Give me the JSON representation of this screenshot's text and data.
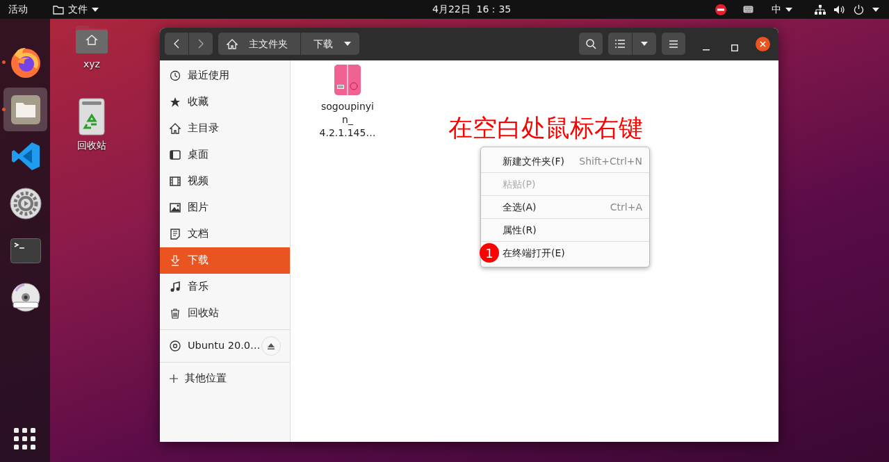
{
  "top_bar": {
    "activities": "活动",
    "app_menu": "文件",
    "clock": "4月22日  16：35",
    "input_method": "中"
  },
  "dock": {
    "apps": [
      {
        "kind": "firefox",
        "running": true,
        "selected": false
      },
      {
        "kind": "files",
        "running": true,
        "selected": true
      },
      {
        "kind": "vscode",
        "running": false,
        "selected": false
      },
      {
        "kind": "settings",
        "running": false,
        "selected": false
      },
      {
        "kind": "terminal",
        "running": false,
        "selected": false
      },
      {
        "kind": "dvd",
        "running": false,
        "selected": false
      }
    ]
  },
  "desktop_icons": [
    {
      "kind": "home-folder",
      "label": "xyz"
    },
    {
      "kind": "trash",
      "label": "回收站"
    }
  ],
  "window": {
    "path": [
      {
        "kind": "home",
        "label": "主文件夹"
      },
      {
        "kind": "folder",
        "label": "下载"
      }
    ],
    "sidebar": {
      "places": [
        {
          "kind": "recent",
          "label": "最近使用",
          "selected": false
        },
        {
          "kind": "starred",
          "label": "收藏",
          "selected": false
        },
        {
          "kind": "home",
          "label": "主目录",
          "selected": false
        },
        {
          "kind": "desktop",
          "label": "桌面",
          "selected": false
        },
        {
          "kind": "videos",
          "label": "视频",
          "selected": false
        },
        {
          "kind": "pictures",
          "label": "图片",
          "selected": false
        },
        {
          "kind": "documents",
          "label": "文档",
          "selected": false
        },
        {
          "kind": "downloads",
          "label": "下载",
          "selected": true
        },
        {
          "kind": "music",
          "label": "音乐",
          "selected": false
        },
        {
          "kind": "trash",
          "label": "回收站",
          "selected": false
        }
      ],
      "devices": [
        {
          "label": "Ubuntu 20.0…"
        }
      ],
      "other": {
        "label": "其他位置"
      }
    },
    "files": [
      {
        "kind": "deb-package",
        "name_lines": [
          "sogoupinyi",
          "n_",
          "4.2.1.145…"
        ]
      }
    ]
  },
  "annotation": "在空白处鼠标右键",
  "context_menu": [
    {
      "label": "新建文件夹(F)",
      "shortcut": "Shift+Ctrl+N",
      "disabled": false
    },
    {
      "label": "粘贴(P)",
      "disabled": true
    },
    {
      "label": "全选(A)",
      "shortcut": "Ctrl+A",
      "disabled": false
    },
    {
      "label": "属性(R)",
      "disabled": false
    },
    {
      "label": "在终端打开(E)",
      "disabled": false,
      "badge": "1"
    }
  ]
}
